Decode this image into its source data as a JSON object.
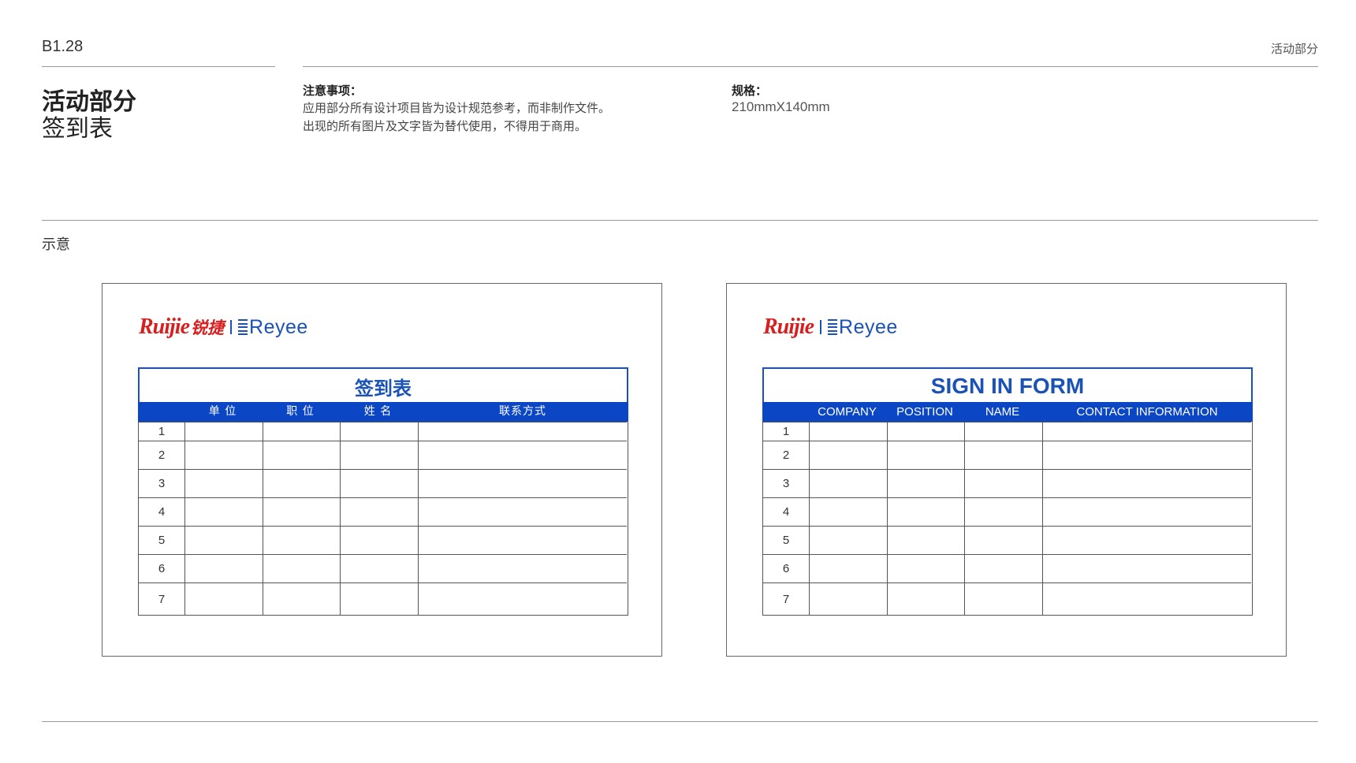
{
  "header": {
    "page_code": "B1.28",
    "section_top": "活动部分"
  },
  "title": {
    "main": "活动部分",
    "sub": "签到表"
  },
  "notes": {
    "heading": "注意事项：",
    "lines": [
      "应用部分所有设计项目皆为设计规范参考，而非制作文件。",
      "出现的所有图片及文字皆为替代使用，不得用于商用。"
    ]
  },
  "spec": {
    "heading": "规格：",
    "value": "210mmX140mm"
  },
  "illustration_label": "示意",
  "cards": [
    {
      "logo": {
        "brand": "Ruijie",
        "brand_cn": "锐捷",
        "partner": "Reyee"
      },
      "form_title": "签到表",
      "columns": [
        "单 位",
        "职 位",
        "姓 名",
        "联系方式"
      ],
      "rows": [
        "1",
        "2",
        "3",
        "4",
        "5",
        "6",
        "7"
      ]
    },
    {
      "logo": {
        "brand": "Ruijie",
        "brand_cn": "",
        "partner": "Reyee"
      },
      "form_title": "SIGN IN FORM",
      "columns": [
        "COMPANY",
        "POSITION",
        "NAME",
        "CONTACT INFORMATION"
      ],
      "rows": [
        "1",
        "2",
        "3",
        "4",
        "5",
        "6",
        "7"
      ]
    }
  ],
  "colors": {
    "accent_blue": "#1a52b5",
    "header_blue": "#0b46c4",
    "brand_red": "#d81e1e",
    "reyee_cyan": "#1aa2c8"
  }
}
